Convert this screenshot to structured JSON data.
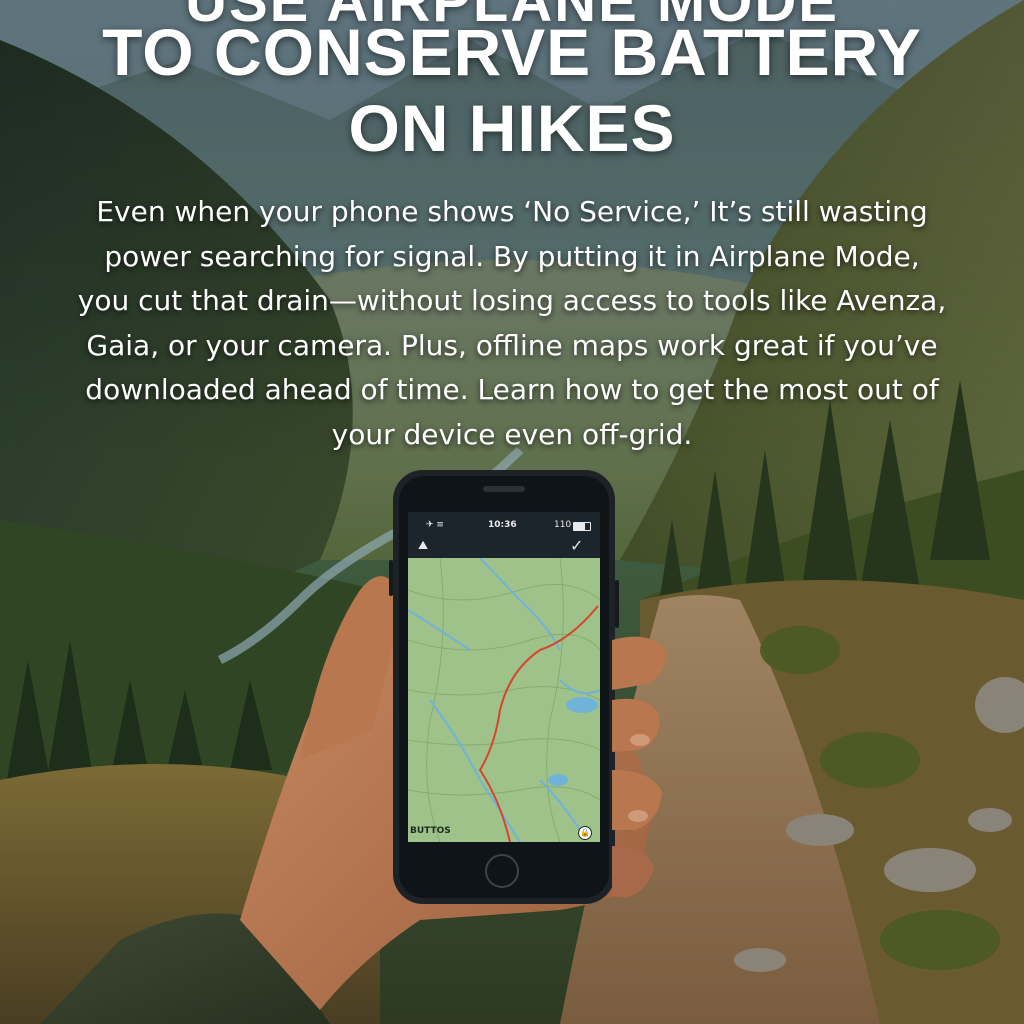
{
  "headline": {
    "cut_off_line": "USE AIRPLANE MODE",
    "line1": "TO CONSERVE BATTERY",
    "line2": "ON HIKES"
  },
  "body": {
    "lines": [
      "Even when your phone shows ‘No Service,’ It’s still wasting",
      "power searching for signal. By putting it in Airplane Mode,",
      "you cut that drain—without losing access to tools like Avenza,",
      "Gaia, or your camera. Plus, offline maps work great if you’ve",
      "downloaded ahead of time. Learn how to get the most out of",
      "your device even off-grid."
    ]
  },
  "phone": {
    "status_left": "✈ ≡",
    "status_time": "10:36",
    "status_right": "110",
    "map_corner_label": "BUTTOS",
    "icons": [
      "hiker-icon",
      "check-icon",
      "lock-icon",
      "battery-icon"
    ]
  },
  "colors": {
    "text": "#ffffff",
    "map_green": "#9fc28a",
    "route": "#d8432c",
    "water": "#6fb3d9",
    "phone_body": "#1c2228"
  }
}
